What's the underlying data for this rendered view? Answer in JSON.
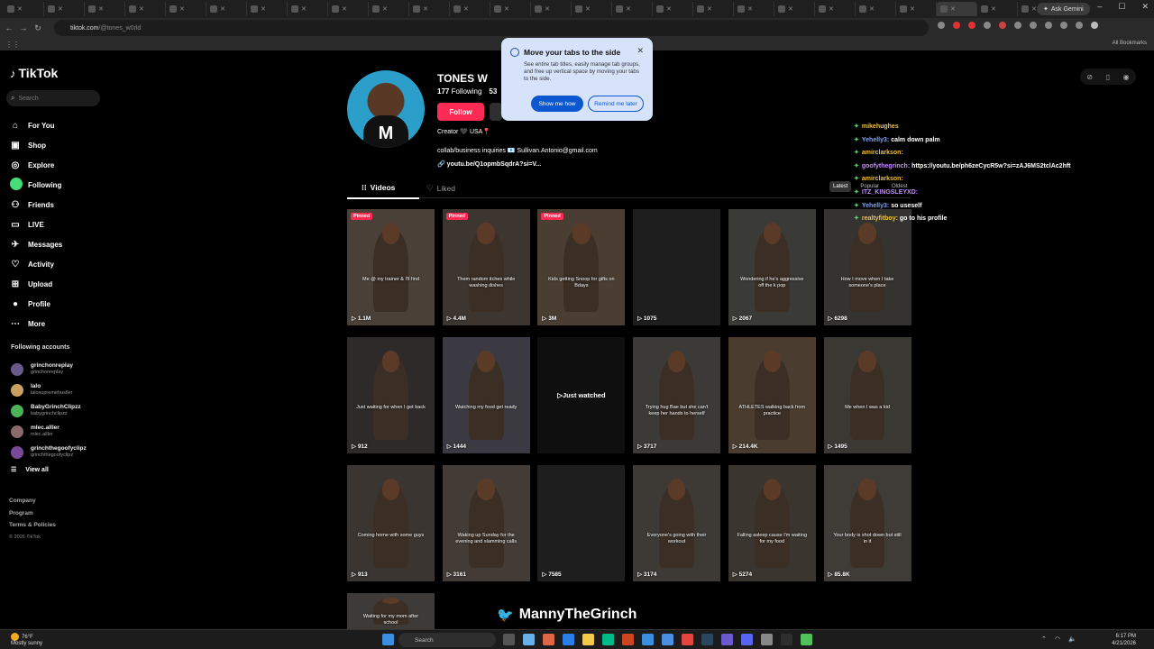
{
  "browser": {
    "tabs_count": 26,
    "ask_gemini": "Ask Gemini",
    "url_domain": "tiktok.com",
    "url_path": "/@tones_w0rld",
    "all_bookmarks": "All Bookmarks"
  },
  "popup": {
    "title": "Move your tabs to the side",
    "body": "See entire tab titles, easily manage tab groups, and free up vertical space by moving your tabs to the side.",
    "primary": "Show me how",
    "secondary": "Remind me later"
  },
  "sidebar": {
    "logo": "TikTok",
    "search_placeholder": "Search",
    "nav": [
      {
        "label": "For You",
        "icon": "home-icon"
      },
      {
        "label": "Shop",
        "icon": "shop-icon"
      },
      {
        "label": "Explore",
        "icon": "compass-icon"
      },
      {
        "label": "Following",
        "icon": "following-avatar-icon"
      },
      {
        "label": "Friends",
        "icon": "friends-icon"
      },
      {
        "label": "LIVE",
        "icon": "live-icon"
      },
      {
        "label": "Messages",
        "icon": "messages-icon"
      },
      {
        "label": "Activity",
        "icon": "activity-icon"
      },
      {
        "label": "Upload",
        "icon": "upload-icon"
      },
      {
        "label": "Profile",
        "icon": "profile-icon"
      },
      {
        "label": "More",
        "icon": "more-icon"
      }
    ],
    "following_title": "Following accounts",
    "following": [
      {
        "name": "grinchonreplay",
        "handle": "grinchonreplay"
      },
      {
        "name": "lalo",
        "handle": "lalosupremehustler"
      },
      {
        "name": "BabyGrinchClipzz",
        "handle": "babygrinchclipzz"
      },
      {
        "name": "mlec.alller",
        "handle": "mlec.alller"
      },
      {
        "name": "grinchthegoofyclipz",
        "handle": "grinchthegoofyclipz"
      }
    ],
    "view_all": "View all",
    "footer": [
      "Company",
      "Program",
      "Terms & Policies"
    ],
    "copyright": "© 2026 TikTok"
  },
  "profile": {
    "name": "TONES W",
    "following_count": "177",
    "following_label": "Following",
    "followers_count": "53",
    "follow": "Follow",
    "bio_line1": "Creator 🖤 USA📍",
    "bio_line2": "collab/business inquiries 📧 Sullivan.Antonio@gmail.com",
    "bio_link": "youtu.be/Q1opmbSqdrA?si=V...",
    "tab_videos": "Videos",
    "tab_liked": "Liked",
    "sort": [
      "Latest",
      "Popular",
      "Oldest"
    ]
  },
  "videos": [
    {
      "views": "1.1M",
      "pinned": true,
      "caption": "Me @ my trainer & I'll find"
    },
    {
      "views": "4.4M",
      "pinned": true,
      "caption": "Them random itches while washing dishes"
    },
    {
      "views": "3M",
      "pinned": true,
      "caption": "Kids getting Snoop for gifts on Bdays"
    },
    {
      "views": "1075",
      "pinned": false,
      "caption": ""
    },
    {
      "views": "2067",
      "pinned": false,
      "caption": "Wondering if he's aggressive off the k pop"
    },
    {
      "views": "6298",
      "pinned": false,
      "caption": "How I move when I take someone's place"
    },
    {
      "views": "912",
      "pinned": false,
      "caption": "Just waiting for when I get back"
    },
    {
      "views": "1444",
      "pinned": false,
      "caption": "Watching my food get ready"
    },
    {
      "views": "",
      "pinned": false,
      "caption": "",
      "just_watched": "Just watched"
    },
    {
      "views": "3717",
      "pinned": false,
      "caption": "Trying hug Bae but she can't keep her hands to herself"
    },
    {
      "views": "214.4K",
      "pinned": false,
      "caption": "ATHLETES walking back from practice"
    },
    {
      "views": "1495",
      "pinned": false,
      "caption": "Me when I was a kid"
    },
    {
      "views": "913",
      "pinned": false,
      "caption": "Coming home with some guys"
    },
    {
      "views": "3161",
      "pinned": false,
      "caption": "Waking up Sunday for the evening and slamming calls"
    },
    {
      "views": "7585",
      "pinned": false,
      "caption": ""
    },
    {
      "views": "3174",
      "pinned": false,
      "caption": "Everyone's going with their workout"
    },
    {
      "views": "5274",
      "pinned": false,
      "caption": "Falling asleep cause I'm waiting for my food"
    },
    {
      "views": "85.8K",
      "pinned": false,
      "caption": "Your body is shot down but still in it"
    },
    {
      "views": "",
      "pinned": false,
      "caption": "Waiting for my mom after school"
    }
  ],
  "chat": [
    {
      "user": "mikehughes",
      "msg": "",
      "cls": "u"
    },
    {
      "user": "Yehelly3:",
      "msg": "calm down palm",
      "cls": "u2"
    },
    {
      "user": "amirclarkson:",
      "msg": "",
      "cls": "u"
    },
    {
      "user": "goofythegrinch:",
      "msg": "https://youtu.be/ph6zeCycR5w?si=zAJ6MS2tclAc2hft",
      "cls": "u3"
    },
    {
      "user": "amirclarkson:",
      "msg": "",
      "cls": "u"
    },
    {
      "user": "ITZ_KINGSLEYXD:",
      "msg": "",
      "cls": "u3"
    },
    {
      "user": "Yehelly3:",
      "msg": "so useself",
      "cls": "u2"
    },
    {
      "user": "realtyfitboy:",
      "msg": "go to his profile",
      "cls": "u"
    }
  ],
  "overlay": {
    "twitter_name": "MannyTheGrinch"
  },
  "taskbar": {
    "temp": "76°F",
    "weather": "Mostly sunny",
    "search": "Search",
    "time": "6:17 PM",
    "date": "4/21/2026"
  }
}
